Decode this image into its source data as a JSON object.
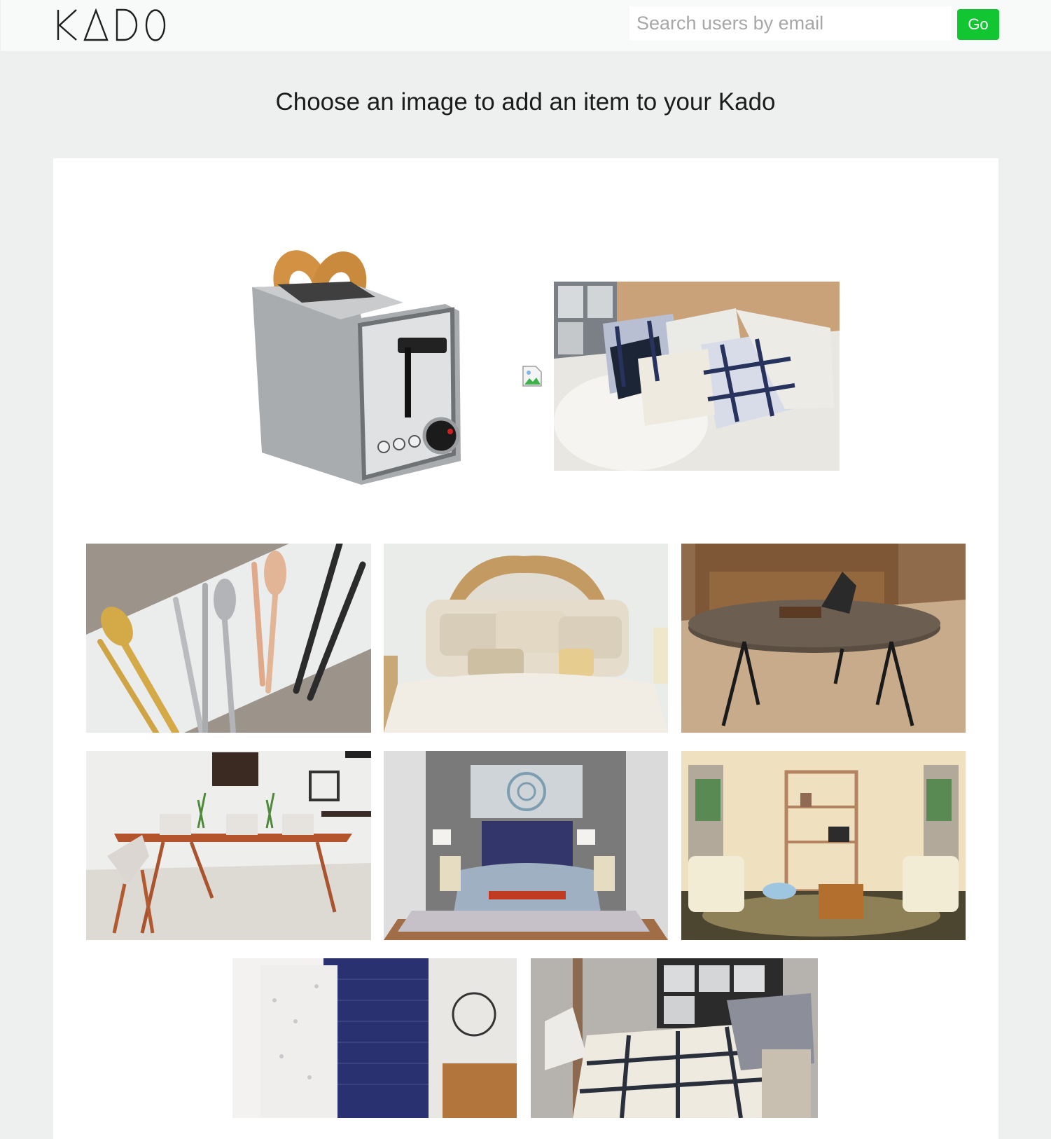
{
  "app": {
    "logo_text": "KADO"
  },
  "search": {
    "placeholder": "Search users by email",
    "value": "",
    "button_label": "Go"
  },
  "page": {
    "heading": "Choose an image to add an item to your Kado"
  },
  "colors": {
    "accent": "#11c631",
    "page_bg": "#eef0f0",
    "topbar_bg": "#f8f9f9",
    "card_bg": "#ffffff"
  },
  "gallery": {
    "items": [
      {
        "name": "toaster-image",
        "subject": "toaster"
      },
      {
        "name": "broken-image-icon",
        "subject": "broken-image"
      },
      {
        "name": "plaid-pillows-image",
        "subject": "pillows"
      },
      {
        "name": "flatware-image",
        "subject": "flatware"
      },
      {
        "name": "ornate-bedding-image",
        "subject": "bedding"
      },
      {
        "name": "coffee-table-image",
        "subject": "coffee-table"
      },
      {
        "name": "dining-table-image",
        "subject": "dining-room"
      },
      {
        "name": "bedroom-image",
        "subject": "bedroom"
      },
      {
        "name": "living-room-image",
        "subject": "living-room"
      },
      {
        "name": "bathroom-image",
        "subject": "bathroom"
      },
      {
        "name": "plaid-bedroom-image",
        "subject": "plaid-bed"
      }
    ]
  }
}
